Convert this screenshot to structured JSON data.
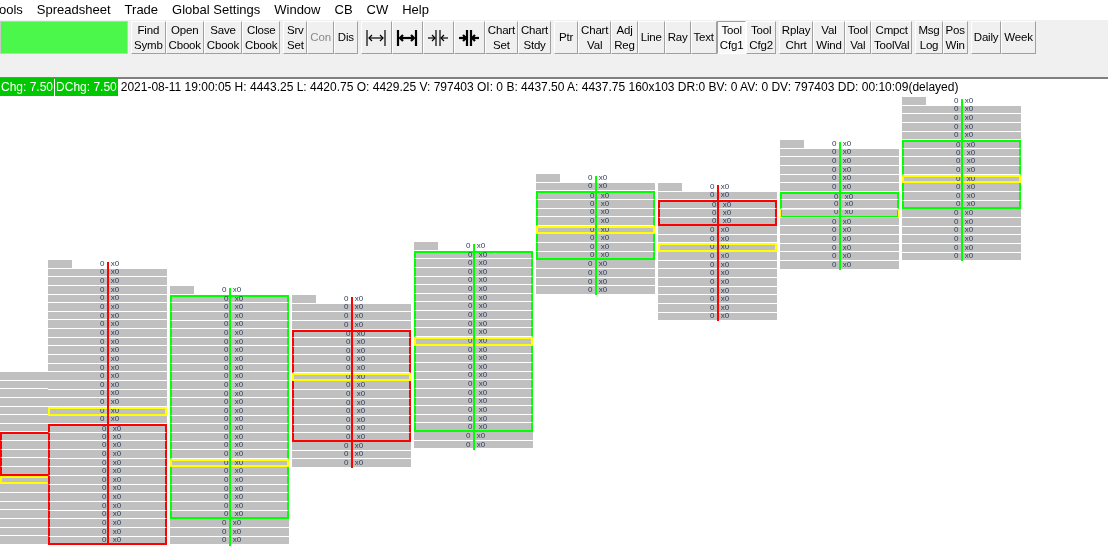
{
  "menu": [
    "ools",
    "Spreadsheet",
    "Trade",
    "Global Settings",
    "Window",
    "CB",
    "CW",
    "Help"
  ],
  "toolbar": {
    "groups": [
      [
        {
          "kind": "text",
          "lines": [
            "Find",
            "Symb"
          ],
          "selected": false,
          "disabled": false
        },
        {
          "kind": "text",
          "lines": [
            "Open",
            "Cbook"
          ],
          "selected": false,
          "disabled": false
        },
        {
          "kind": "text",
          "lines": [
            "Save",
            "Cbook"
          ],
          "selected": false,
          "disabled": false
        },
        {
          "kind": "text",
          "lines": [
            "Close",
            "Cbook"
          ],
          "selected": false,
          "disabled": false
        }
      ],
      [
        {
          "kind": "text",
          "lines": [
            "Srv",
            "Set"
          ],
          "selected": false,
          "disabled": false
        },
        {
          "kind": "text",
          "lines": [
            "Con"
          ],
          "selected": false,
          "disabled": true
        },
        {
          "kind": "text",
          "lines": [
            "Dis"
          ],
          "selected": false,
          "disabled": false
        }
      ],
      [
        {
          "kind": "icon",
          "selected": false,
          "disabled": false
        },
        {
          "kind": "icon",
          "selected": false,
          "disabled": false
        },
        {
          "kind": "icon",
          "selected": false,
          "disabled": false
        },
        {
          "kind": "icon",
          "selected": false,
          "disabled": false
        },
        {
          "kind": "text",
          "lines": [
            "Chart",
            "Set"
          ],
          "selected": false,
          "disabled": false
        },
        {
          "kind": "text",
          "lines": [
            "Chart",
            "Stdy"
          ],
          "selected": false,
          "disabled": false
        }
      ],
      [
        {
          "kind": "text",
          "lines": [
            "Ptr"
          ],
          "selected": false,
          "disabled": false
        },
        {
          "kind": "text",
          "lines": [
            "Chart",
            "Val"
          ],
          "selected": false,
          "disabled": false
        },
        {
          "kind": "text",
          "lines": [
            "Adj",
            "Reg"
          ],
          "selected": false,
          "disabled": false
        },
        {
          "kind": "text",
          "lines": [
            "Line"
          ],
          "selected": false,
          "disabled": false
        },
        {
          "kind": "text",
          "lines": [
            "Ray"
          ],
          "selected": false,
          "disabled": false
        },
        {
          "kind": "text",
          "lines": [
            "Text"
          ],
          "selected": false,
          "disabled": false
        },
        {
          "kind": "text",
          "lines": [
            "Tool",
            "Cfg1"
          ],
          "selected": true,
          "disabled": false
        },
        {
          "kind": "text",
          "lines": [
            "Tool",
            "Cfg2"
          ],
          "selected": false,
          "disabled": false
        }
      ],
      [
        {
          "kind": "text",
          "lines": [
            "Rplay",
            "Chrt"
          ],
          "selected": false,
          "disabled": false
        },
        {
          "kind": "text",
          "lines": [
            "Val",
            "Wind"
          ],
          "selected": false,
          "disabled": false
        },
        {
          "kind": "text",
          "lines": [
            "Tool",
            "Val"
          ],
          "selected": false,
          "disabled": false
        },
        {
          "kind": "text",
          "lines": [
            "Cmpct",
            "ToolVal"
          ],
          "selected": false,
          "disabled": false
        }
      ],
      [
        {
          "kind": "text",
          "lines": [
            "Msg",
            "Log"
          ],
          "selected": false,
          "disabled": false
        },
        {
          "kind": "text",
          "lines": [
            "Pos",
            "Win"
          ],
          "selected": false,
          "disabled": false
        }
      ],
      [
        {
          "kind": "text",
          "lines": [
            "Daily"
          ],
          "selected": false,
          "disabled": false
        },
        {
          "kind": "text",
          "lines": [
            "Week"
          ],
          "selected": false,
          "disabled": false
        }
      ]
    ]
  },
  "info": {
    "badges": [
      {
        "text": "Chg: 7.50",
        "color": "#00c800"
      },
      {
        "text": "DChg: 7.50",
        "color": "#00c800"
      }
    ],
    "text": "2021-08-11 19:00:05 H: 4443.25 L: 4420.75 O: 4429.25 V: 797403 OI: 0 B: 4437.50 A: 4437.75 160x103 DR:0 BV: 0 AV: 0 DV: 797403 DD: 00:10:09(delayed)"
  },
  "columns": [
    {
      "color": "#ff0000",
      "cells": [
        {
          "body": false,
          "poc": false
        },
        {
          "body": false,
          "poc": false
        },
        {
          "body": false,
          "poc": false
        },
        {
          "body": false,
          "poc": false
        },
        {
          "body": false,
          "poc": false
        },
        {
          "body": false,
          "poc": false
        },
        {
          "body": false,
          "poc": false
        },
        {
          "body": true,
          "poc": false
        },
        {
          "body": true,
          "poc": false
        },
        {
          "body": true,
          "poc": false
        },
        {
          "body": true,
          "poc": false
        },
        {
          "body": true,
          "poc": false
        },
        {
          "body": false,
          "poc": true
        },
        {
          "body": false,
          "poc": false
        },
        {
          "body": false,
          "poc": false
        },
        {
          "body": false,
          "poc": false
        },
        {
          "body": false,
          "poc": false
        },
        {
          "body": false,
          "poc": false
        },
        {
          "body": false,
          "poc": false
        },
        {
          "body": false,
          "poc": false
        }
      ]
    },
    {
      "color": "#ff0000",
      "cells": [
        {
          "text": "0 x0",
          "body": false,
          "poc": false
        },
        {
          "text": "0 x0",
          "body": false,
          "poc": false
        },
        {
          "text": "0 x0",
          "body": false,
          "poc": false
        },
        {
          "text": "0 x0",
          "body": false,
          "poc": false
        },
        {
          "text": "0 x0",
          "body": false,
          "poc": false
        },
        {
          "text": "0 x0",
          "body": false,
          "poc": false
        },
        {
          "text": "0 x0",
          "body": false,
          "poc": false
        },
        {
          "text": "0 x0",
          "body": false,
          "poc": false
        },
        {
          "text": "0 x0",
          "body": false,
          "poc": false
        },
        {
          "text": "0 x0",
          "body": false,
          "poc": false
        },
        {
          "text": "0 x0",
          "body": false,
          "poc": false
        },
        {
          "text": "0 x0",
          "body": false,
          "poc": false
        },
        {
          "text": "0 x0",
          "body": false,
          "poc": false
        },
        {
          "text": "0 x0",
          "body": false,
          "poc": false
        },
        {
          "text": "0 x0",
          "body": false,
          "poc": false
        },
        {
          "text": "0 x0",
          "body": false,
          "poc": false
        },
        {
          "text": "0 x0",
          "body": false,
          "poc": false
        },
        {
          "text": "0 x0",
          "body": false,
          "poc": true
        },
        {
          "text": "0 x0",
          "body": false,
          "poc": false
        },
        {
          "text": "0 x0",
          "body": true,
          "poc": false
        },
        {
          "text": "0 x0",
          "body": true,
          "poc": false
        },
        {
          "text": "0 x0",
          "body": true,
          "poc": false
        },
        {
          "text": "0 x0",
          "body": true,
          "poc": false
        },
        {
          "text": "0 x0",
          "body": true,
          "poc": false
        },
        {
          "text": "0 x0",
          "body": true,
          "poc": false
        },
        {
          "text": "0 x0",
          "body": true,
          "poc": false
        },
        {
          "text": "0 x0",
          "body": true,
          "poc": false
        },
        {
          "text": "0 x0",
          "body": true,
          "poc": false
        },
        {
          "text": "0 x0",
          "body": true,
          "poc": false
        },
        {
          "text": "0 x0",
          "body": true,
          "poc": false
        },
        {
          "text": "0 x0",
          "body": true,
          "poc": false
        },
        {
          "text": "0 x0",
          "body": true,
          "poc": false
        },
        {
          "text": "0 x0",
          "body": true,
          "poc": false
        }
      ]
    },
    {
      "color": "#00ff00",
      "cells": [
        {
          "text": "0 x0",
          "body": false,
          "poc": false
        },
        {
          "text": "0 x0",
          "body": true,
          "poc": false
        },
        {
          "text": "0 x0",
          "body": true,
          "poc": false
        },
        {
          "text": "0 x0",
          "body": true,
          "poc": false
        },
        {
          "text": "0 x0",
          "body": true,
          "poc": false
        },
        {
          "text": "0 x0",
          "body": true,
          "poc": false
        },
        {
          "text": "0 x0",
          "body": true,
          "poc": false
        },
        {
          "text": "0 x0",
          "body": true,
          "poc": false
        },
        {
          "text": "0 x0",
          "body": true,
          "poc": false
        },
        {
          "text": "0 x0",
          "body": true,
          "poc": false
        },
        {
          "text": "0 x0",
          "body": true,
          "poc": false
        },
        {
          "text": "0 x0",
          "body": true,
          "poc": false
        },
        {
          "text": "0 x0",
          "body": true,
          "poc": false
        },
        {
          "text": "0 x0",
          "body": true,
          "poc": false
        },
        {
          "text": "0 x0",
          "body": true,
          "poc": false
        },
        {
          "text": "0 x0",
          "body": true,
          "poc": false
        },
        {
          "text": "0 x0",
          "body": true,
          "poc": false
        },
        {
          "text": "0 x0",
          "body": true,
          "poc": false
        },
        {
          "text": "0 x0",
          "body": true,
          "poc": false
        },
        {
          "text": "0 x0",
          "body": true,
          "poc": false
        },
        {
          "text": "0 x0",
          "body": true,
          "poc": true
        },
        {
          "text": "0 x0",
          "body": true,
          "poc": false
        },
        {
          "text": "0 x0",
          "body": true,
          "poc": false
        },
        {
          "text": "0 x0",
          "body": true,
          "poc": false
        },
        {
          "text": "0 x0",
          "body": true,
          "poc": false
        },
        {
          "text": "0 x0",
          "body": true,
          "poc": false
        },
        {
          "text": "0 x0",
          "body": true,
          "poc": false
        },
        {
          "text": "0 x0",
          "body": false,
          "poc": false
        },
        {
          "text": "0 x0",
          "body": false,
          "poc": false
        },
        {
          "text": "0 x0",
          "body": false,
          "poc": false
        }
      ]
    },
    {
      "color": "#ff0000",
      "cells": [
        {
          "text": "0 x0",
          "body": false,
          "poc": false
        },
        {
          "text": "0 x0",
          "body": false,
          "poc": false
        },
        {
          "text": "0 x0",
          "body": false,
          "poc": false
        },
        {
          "text": "0 x0",
          "body": false,
          "poc": false
        },
        {
          "text": "0 x0",
          "body": true,
          "poc": false
        },
        {
          "text": "0 x0",
          "body": true,
          "poc": false
        },
        {
          "text": "0 x0",
          "body": true,
          "poc": false
        },
        {
          "text": "0 x0",
          "body": true,
          "poc": false
        },
        {
          "text": "0 x0",
          "body": true,
          "poc": false
        },
        {
          "text": "0 x0",
          "body": true,
          "poc": true
        },
        {
          "text": "0 x0",
          "body": true,
          "poc": false
        },
        {
          "text": "0 x0",
          "body": true,
          "poc": false
        },
        {
          "text": "0 x0",
          "body": true,
          "poc": false
        },
        {
          "text": "0 x0",
          "body": true,
          "poc": false
        },
        {
          "text": "0 x0",
          "body": true,
          "poc": false
        },
        {
          "text": "0 x0",
          "body": true,
          "poc": false
        },
        {
          "text": "0 x0",
          "body": true,
          "poc": false
        },
        {
          "text": "0 x0",
          "body": false,
          "poc": false
        },
        {
          "text": "0 x0",
          "body": false,
          "poc": false
        },
        {
          "text": "0 x0",
          "body": false,
          "poc": false
        }
      ]
    },
    {
      "color": "#00ff00",
      "cells": [
        {
          "text": "0 x0",
          "body": false,
          "poc": false
        },
        {
          "text": "0 x0",
          "body": true,
          "poc": false
        },
        {
          "text": "0 x0",
          "body": true,
          "poc": false
        },
        {
          "text": "0 x0",
          "body": true,
          "poc": false
        },
        {
          "text": "0 x0",
          "body": true,
          "poc": false
        },
        {
          "text": "0 x0",
          "body": true,
          "poc": false
        },
        {
          "text": "0 x0",
          "body": true,
          "poc": false
        },
        {
          "text": "0 x0",
          "body": true,
          "poc": false
        },
        {
          "text": "0 x0",
          "body": true,
          "poc": false
        },
        {
          "text": "0 x0",
          "body": true,
          "poc": false
        },
        {
          "text": "0 x0",
          "body": true,
          "poc": false
        },
        {
          "text": "0 x0",
          "body": true,
          "poc": true
        },
        {
          "text": "0 x0",
          "body": true,
          "poc": false
        },
        {
          "text": "0 x0",
          "body": true,
          "poc": false
        },
        {
          "text": "0 x0",
          "body": true,
          "poc": false
        },
        {
          "text": "0 x0",
          "body": true,
          "poc": false
        },
        {
          "text": "0 x0",
          "body": true,
          "poc": false
        },
        {
          "text": "0 x0",
          "body": true,
          "poc": false
        },
        {
          "text": "0 x0",
          "body": true,
          "poc": false
        },
        {
          "text": "0 x0",
          "body": true,
          "poc": false
        },
        {
          "text": "0 x0",
          "body": true,
          "poc": false
        },
        {
          "text": "0 x0",
          "body": true,
          "poc": false
        },
        {
          "text": "0 x0",
          "body": false,
          "poc": false
        },
        {
          "text": "0 x0",
          "body": false,
          "poc": false
        }
      ]
    },
    {
      "color": "#00ff00",
      "cells": [
        {
          "text": "0 x0",
          "body": false,
          "poc": false
        },
        {
          "text": "0 x0",
          "body": false,
          "poc": false
        },
        {
          "text": "0 x0",
          "body": true,
          "poc": false
        },
        {
          "text": "0 x0",
          "body": true,
          "poc": false
        },
        {
          "text": "0 x0",
          "body": true,
          "poc": false
        },
        {
          "text": "0 x0",
          "body": true,
          "poc": false
        },
        {
          "text": "0 x0",
          "body": true,
          "poc": true
        },
        {
          "text": "0 x0",
          "body": true,
          "poc": false
        },
        {
          "text": "0 x0",
          "body": true,
          "poc": false
        },
        {
          "text": "0 x0",
          "body": true,
          "poc": false
        },
        {
          "text": "0 x0",
          "body": false,
          "poc": false
        },
        {
          "text": "0 x0",
          "body": false,
          "poc": false
        },
        {
          "text": "0 x0",
          "body": false,
          "poc": false
        },
        {
          "text": "0 x0",
          "body": false,
          "poc": false
        }
      ]
    },
    {
      "color": "#ff0000",
      "cells": [
        {
          "text": "0 x0",
          "body": false,
          "poc": false
        },
        {
          "text": "0 x0",
          "body": false,
          "poc": false
        },
        {
          "text": "0 x0",
          "body": true,
          "poc": false
        },
        {
          "text": "0 x0",
          "body": true,
          "poc": false
        },
        {
          "text": "0 x0",
          "body": true,
          "poc": false
        },
        {
          "text": "0 x0",
          "body": false,
          "poc": false
        },
        {
          "text": "0 x0",
          "body": false,
          "poc": false
        },
        {
          "text": "0 x0",
          "body": false,
          "poc": true
        },
        {
          "text": "0 x0",
          "body": false,
          "poc": false
        },
        {
          "text": "0 x0",
          "body": false,
          "poc": false
        },
        {
          "text": "0 x0",
          "body": false,
          "poc": false
        },
        {
          "text": "0 x0",
          "body": false,
          "poc": false
        },
        {
          "text": "0 x0",
          "body": false,
          "poc": false
        },
        {
          "text": "0 x0",
          "body": false,
          "poc": false
        },
        {
          "text": "0 x0",
          "body": false,
          "poc": false
        },
        {
          "text": "0 x0",
          "body": false,
          "poc": false
        }
      ]
    },
    {
      "color": "#00ff00",
      "cells": [
        {
          "text": "0 x0",
          "body": false,
          "poc": false
        },
        {
          "text": "0 x0",
          "body": false,
          "poc": false
        },
        {
          "text": "0 x0",
          "body": false,
          "poc": false
        },
        {
          "text": "0 x0",
          "body": false,
          "poc": false
        },
        {
          "text": "0 x0",
          "body": false,
          "poc": false
        },
        {
          "text": "0 x0",
          "body": false,
          "poc": false
        },
        {
          "text": "0 x0",
          "body": true,
          "poc": false
        },
        {
          "text": "0 x0",
          "body": true,
          "poc": false
        },
        {
          "text": "0 x0",
          "body": true,
          "poc": true
        },
        {
          "text": "0 x0",
          "body": false,
          "poc": false
        },
        {
          "text": "0 x0",
          "body": false,
          "poc": false
        },
        {
          "text": "0 x0",
          "body": false,
          "poc": false
        },
        {
          "text": "0 x0",
          "body": false,
          "poc": false
        },
        {
          "text": "0 x0",
          "body": false,
          "poc": false
        },
        {
          "text": "0 x0",
          "body": false,
          "poc": false
        }
      ]
    },
    {
      "color": "#00ff00",
      "cells": [
        {
          "text": "0 x0",
          "body": false,
          "poc": false
        },
        {
          "text": "0 x0",
          "body": false,
          "poc": false
        },
        {
          "text": "0 x0",
          "body": false,
          "poc": false
        },
        {
          "text": "0 x0",
          "body": false,
          "poc": false
        },
        {
          "text": "0 x0",
          "body": false,
          "poc": false
        },
        {
          "text": "0 x0",
          "body": true,
          "poc": false
        },
        {
          "text": "0 x0",
          "body": true,
          "poc": false
        },
        {
          "text": "0 x0",
          "body": true,
          "poc": false
        },
        {
          "text": "0 x0",
          "body": true,
          "poc": false
        },
        {
          "text": "0 x0",
          "body": true,
          "poc": true
        },
        {
          "text": "0 x0",
          "body": true,
          "poc": false
        },
        {
          "text": "0 x0",
          "body": true,
          "poc": false
        },
        {
          "text": "0 x0",
          "body": true,
          "poc": false
        },
        {
          "text": "0 x0",
          "body": false,
          "poc": false
        },
        {
          "text": "0 x0",
          "body": false,
          "poc": false
        },
        {
          "text": "0 x0",
          "body": false,
          "poc": false
        },
        {
          "text": "0 x0",
          "body": false,
          "poc": false
        },
        {
          "text": "0 x0",
          "body": false,
          "poc": false
        },
        {
          "text": "0 x0",
          "body": false,
          "poc": false
        }
      ]
    }
  ]
}
